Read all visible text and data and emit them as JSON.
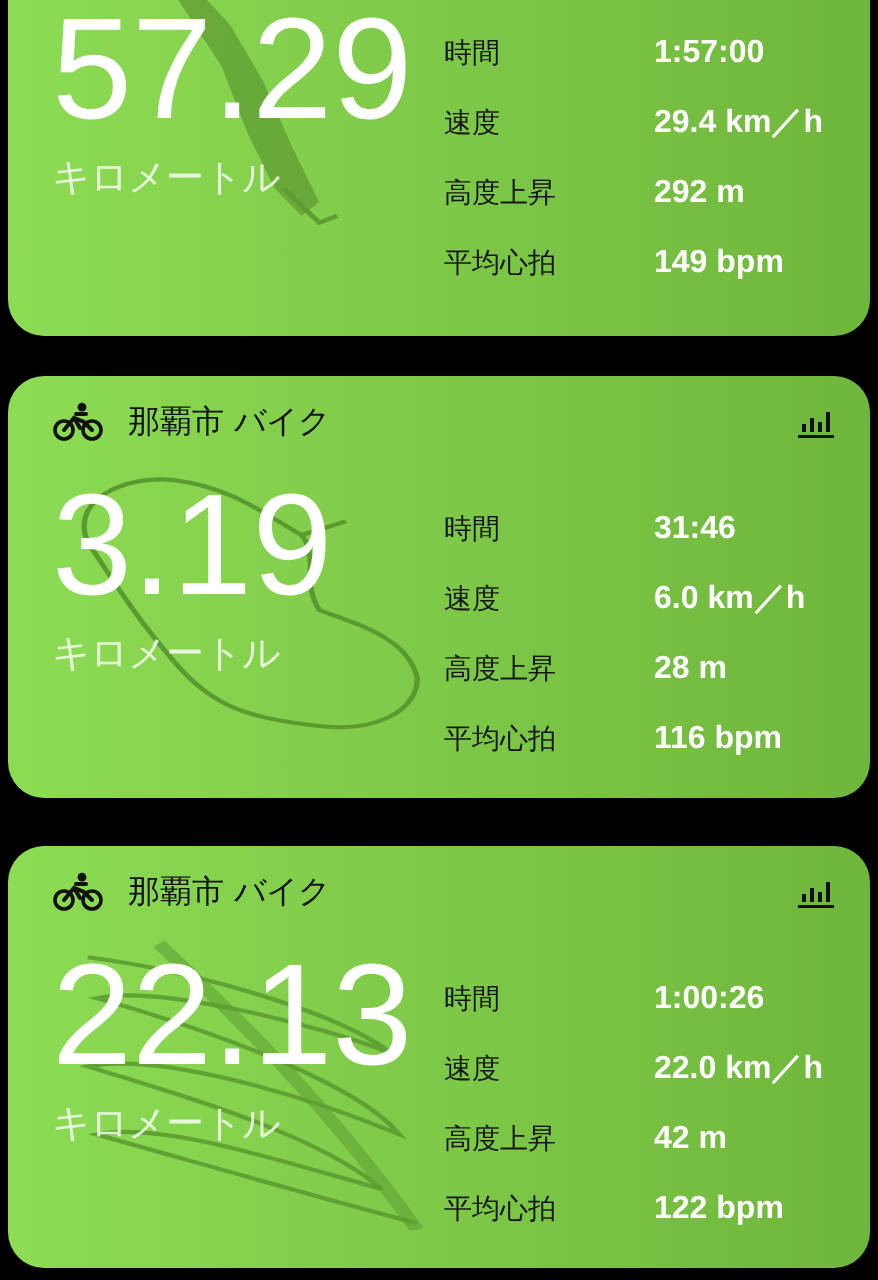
{
  "workouts": [
    {
      "distance": "57.29",
      "unit": "キロメートル",
      "route": {
        "kind": "strip"
      },
      "stats": [
        {
          "label": "時間",
          "value": "1:57:00"
        },
        {
          "label": "速度",
          "value": "29.4 km／h"
        },
        {
          "label": "高度上昇",
          "value": "292 m"
        },
        {
          "label": "平均心拍",
          "value": "149 bpm"
        }
      ]
    },
    {
      "header": {
        "title": "那覇市 バイク"
      },
      "distance": "3.19",
      "unit": "キロメートル",
      "route": {
        "kind": "loop"
      },
      "stats": [
        {
          "label": "時間",
          "value": "31:46"
        },
        {
          "label": "速度",
          "value": "6.0 km／h"
        },
        {
          "label": "高度上昇",
          "value": "28 m"
        },
        {
          "label": "平均心拍",
          "value": "116 bpm"
        }
      ]
    },
    {
      "header": {
        "title": "那覇市 バイク"
      },
      "distance": "22.13",
      "unit": "キロメートル",
      "route": {
        "kind": "scribble"
      },
      "stats": [
        {
          "label": "時間",
          "value": "1:00:26"
        },
        {
          "label": "速度",
          "value": "22.0 km／h"
        },
        {
          "label": "高度上昇",
          "value": "42 m"
        },
        {
          "label": "平均心拍",
          "value": "122 bpm"
        }
      ]
    }
  ]
}
